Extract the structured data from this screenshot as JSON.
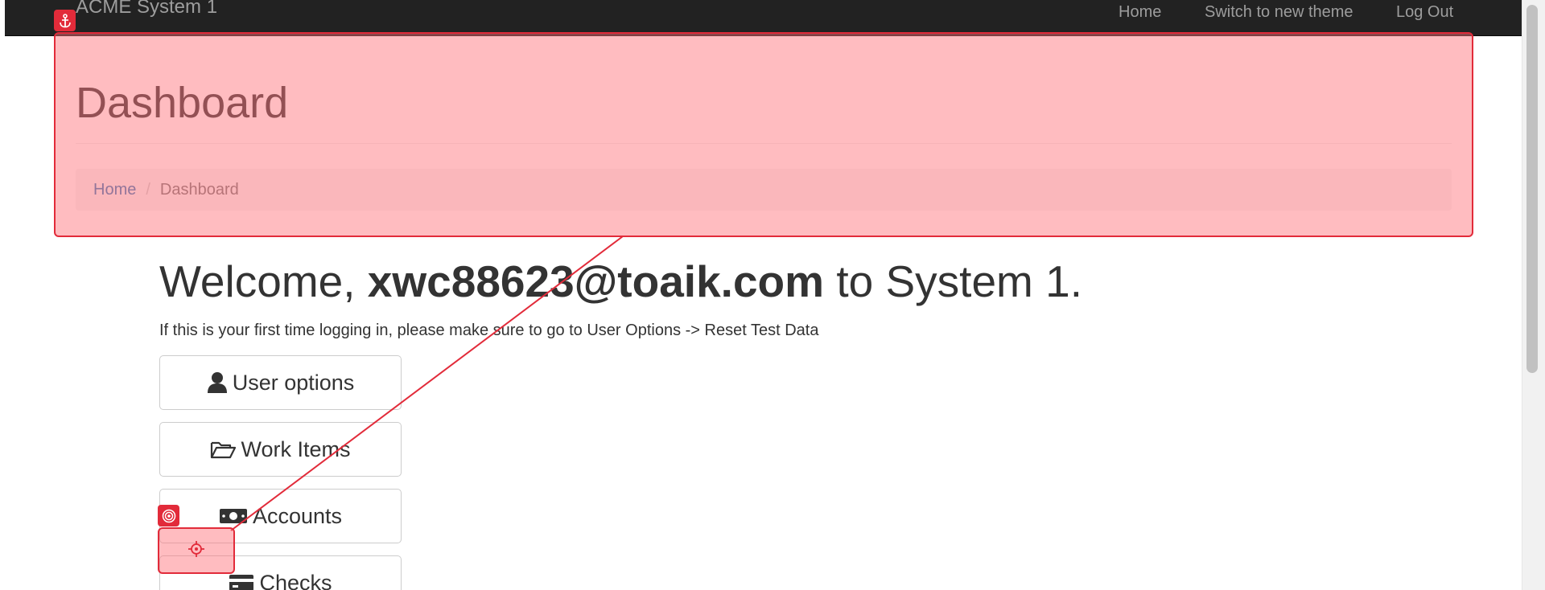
{
  "navbar": {
    "brand": "ACME System 1",
    "links": [
      "Home",
      "Switch to new theme",
      "Log Out"
    ]
  },
  "header": {
    "title": "Dashboard",
    "breadcrumb": {
      "home": "Home",
      "separator": "/",
      "current": "Dashboard"
    }
  },
  "main": {
    "welcome_prefix": "Welcome, ",
    "welcome_user": "xwc88623@toaik.com",
    "welcome_suffix": " to System 1.",
    "info": "If this is your first time logging in, please make sure to go to User Options -> Reset Test Data",
    "buttons": [
      {
        "label": "User options",
        "icon": "user-icon"
      },
      {
        "label": "Work Items",
        "icon": "folder-open-icon"
      },
      {
        "label": "Accounts",
        "icon": "money-icon"
      },
      {
        "label": "Checks",
        "icon": "credit-card-icon"
      }
    ]
  },
  "overlay": {
    "highlight_color": "#e22b3a",
    "anchor_icon": "anchor-icon",
    "target_icon": "target-icon",
    "crosshair_icon": "crosshair-icon"
  },
  "colors": {
    "navbar_bg": "#222222",
    "navbar_text": "#9d9d9d",
    "link": "#337ab7",
    "breadcrumb_bg": "#f5f5f5"
  }
}
